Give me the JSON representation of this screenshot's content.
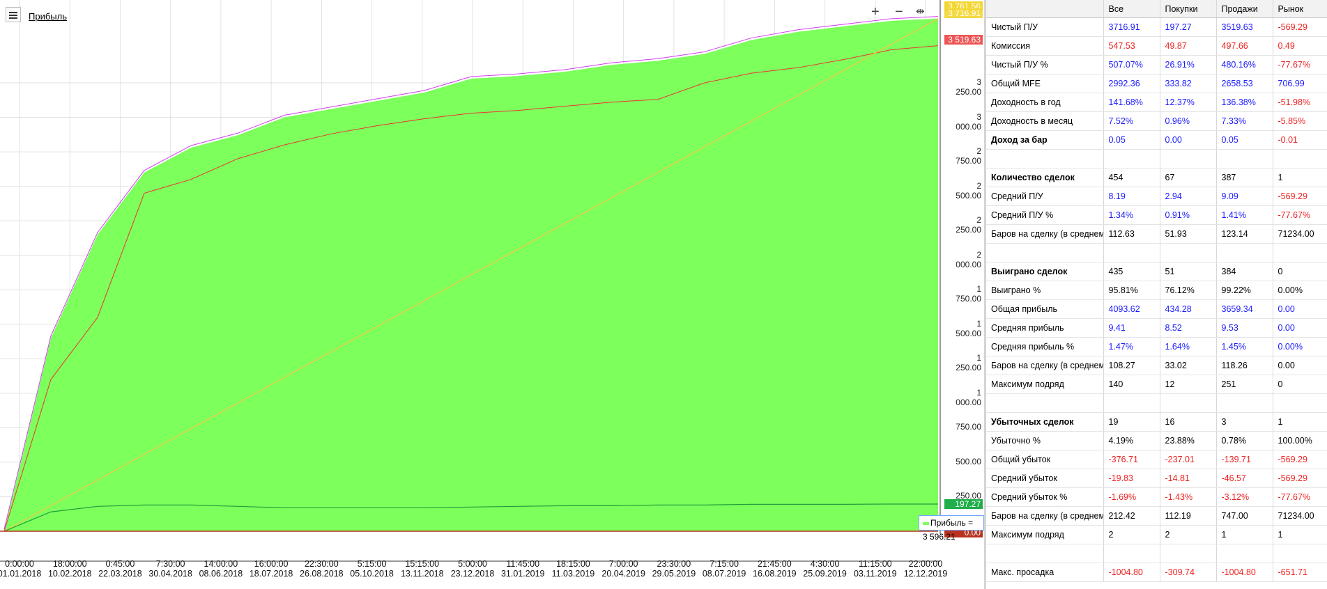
{
  "chart": {
    "title": "Прибыль",
    "tooltip": "Прибыль = 3 596.21",
    "value_tags": {
      "top": "3 761.56",
      "top2": "3 716.91",
      "red": "3 519.63",
      "green": "197.27",
      "zero": "0.00"
    },
    "colors": {
      "area": "#7dff5c",
      "max_line": "#d23cf0",
      "profit_line": "#ee3333",
      "trend_line": "#f5c542",
      "long_line": "#1f9e3c",
      "short_line": "#b8321f",
      "tag_yellow": "#f3d630",
      "tag_red": "#ee5555",
      "tag_green": "#1fae4a",
      "tag_brown": "#b8321f"
    },
    "icons": [
      "list-icon",
      "zoom-in-icon",
      "zoom-out-icon",
      "fit-icon"
    ]
  },
  "chart_data": {
    "type": "area",
    "title": "Прибыль",
    "ylim": [
      0,
      3800
    ],
    "y_ticks": [
      "250.00",
      "500.00",
      "750.00",
      "1 000.00",
      "1 250.00",
      "1 500.00",
      "1 750.00",
      "2 000.00",
      "2 250.00",
      "2 500.00",
      "2 750.00",
      "3 000.00",
      "3 250.00"
    ],
    "y_tick_values": [
      250,
      500,
      750,
      1000,
      1250,
      1500,
      1750,
      2000,
      2250,
      2500,
      2750,
      3000,
      3250
    ],
    "x_ticks": [
      {
        "time": "0:00:00",
        "date": "01.01.2018"
      },
      {
        "time": "18:00:00",
        "date": "10.02.2018"
      },
      {
        "time": "0:45:00",
        "date": "22.03.2018"
      },
      {
        "time": "7:30:00",
        "date": "30.04.2018"
      },
      {
        "time": "14:00:00",
        "date": "08.06.2018"
      },
      {
        "time": "16:00:00",
        "date": "18.07.2018"
      },
      {
        "time": "22:30:00",
        "date": "26.08.2018"
      },
      {
        "time": "5:15:00",
        "date": "05.10.2018"
      },
      {
        "time": "15:15:00",
        "date": "13.11.2018"
      },
      {
        "time": "5:00:00",
        "date": "23.12.2018"
      },
      {
        "time": "11:45:00",
        "date": "31.01.2019"
      },
      {
        "time": "18:15:00",
        "date": "11.03.2019"
      },
      {
        "time": "7:00:00",
        "date": "20.04.2019"
      },
      {
        "time": "23:30:00",
        "date": "29.05.2019"
      },
      {
        "time": "7:15:00",
        "date": "08.07.2019"
      },
      {
        "time": "21:45:00",
        "date": "16.08.2019"
      },
      {
        "time": "4:30:00",
        "date": "25.09.2019"
      },
      {
        "time": "11:15:00",
        "date": "03.11.2019"
      },
      {
        "time": "22:00:00",
        "date": "12.12.2019"
      }
    ],
    "series": [
      {
        "name": "Прибыль",
        "values": [
          0,
          1400,
          2150,
          2600,
          2780,
          2870,
          3000,
          3060,
          3120,
          3180,
          3280,
          3300,
          3330,
          3380,
          3410,
          3460,
          3560,
          3620,
          3660,
          3700,
          3716
        ]
      },
      {
        "name": "",
        "values": [
          0,
          1100,
          1550,
          2450,
          2550,
          2700,
          2800,
          2880,
          2940,
          2990,
          3030,
          3050,
          3080,
          3110,
          3130,
          3250,
          3320,
          3360,
          3420,
          3490,
          3519
        ]
      },
      {
        "name": "",
        "values": [
          0,
          140,
          180,
          190,
          190,
          180,
          170,
          170,
          170,
          170,
          175,
          180,
          185,
          185,
          190,
          190,
          195,
          195,
          195,
          197,
          197
        ]
      }
    ],
    "x_index": [
      0,
      1,
      2,
      3,
      4,
      5,
      6,
      7,
      8,
      9,
      10,
      11,
      12,
      13,
      14,
      15,
      16,
      17,
      18,
      19,
      20
    ]
  },
  "stats": {
    "columns": [
      "",
      "Все",
      "Покупки",
      "Продажи",
      "Рынок"
    ],
    "rows": [
      {
        "label": "Чистый П/У",
        "bold": false,
        "vals": [
          "3716.91",
          "197.27",
          "3519.63",
          "-569.29"
        ],
        "colors": [
          "blue",
          "blue",
          "blue",
          "red"
        ]
      },
      {
        "label": "Комиссия",
        "bold": false,
        "vals": [
          "547.53",
          "49.87",
          "497.66",
          "0.49"
        ],
        "colors": [
          "red",
          "red",
          "red",
          "red"
        ]
      },
      {
        "label": "Чистый П/У %",
        "bold": false,
        "vals": [
          "507.07%",
          "26.91%",
          "480.16%",
          "-77.67%"
        ],
        "colors": [
          "blue",
          "blue",
          "blue",
          "red"
        ]
      },
      {
        "label": "Общий MFE",
        "bold": false,
        "vals": [
          "2992.36",
          "333.82",
          "2658.53",
          "706.99"
        ],
        "colors": [
          "blue",
          "blue",
          "blue",
          "blue"
        ]
      },
      {
        "label": "Доходность в год",
        "bold": false,
        "vals": [
          "141.68%",
          "12.37%",
          "136.38%",
          "-51.98%"
        ],
        "colors": [
          "blue",
          "blue",
          "blue",
          "red"
        ]
      },
      {
        "label": "Доходность в месяц",
        "bold": false,
        "vals": [
          "7.52%",
          "0.96%",
          "7.33%",
          "-5.85%"
        ],
        "colors": [
          "blue",
          "blue",
          "blue",
          "red"
        ]
      },
      {
        "label": "Доход за бар",
        "bold": true,
        "vals": [
          "0.05",
          "0.00",
          "0.05",
          "-0.01"
        ],
        "colors": [
          "blue",
          "blue",
          "blue",
          "red"
        ]
      },
      {
        "label": "",
        "bold": false,
        "vals": [
          "",
          "",
          "",
          ""
        ],
        "colors": [
          "black",
          "black",
          "black",
          "black"
        ]
      },
      {
        "label": "Количество сделок",
        "bold": true,
        "vals": [
          "454",
          "67",
          "387",
          "1"
        ],
        "colors": [
          "black",
          "black",
          "black",
          "black"
        ]
      },
      {
        "label": "Средний П/У",
        "bold": false,
        "vals": [
          "8.19",
          "2.94",
          "9.09",
          "-569.29"
        ],
        "colors": [
          "blue",
          "blue",
          "blue",
          "red"
        ]
      },
      {
        "label": "Средний П/У %",
        "bold": false,
        "vals": [
          "1.34%",
          "0.91%",
          "1.41%",
          "-77.67%"
        ],
        "colors": [
          "blue",
          "blue",
          "blue",
          "red"
        ]
      },
      {
        "label": "Баров на сделку (в среднем)",
        "bold": false,
        "vals": [
          "112.63",
          "51.93",
          "123.14",
          "71234.00"
        ],
        "colors": [
          "black",
          "black",
          "black",
          "black"
        ]
      },
      {
        "label": "",
        "bold": false,
        "vals": [
          "",
          "",
          "",
          ""
        ],
        "colors": [
          "black",
          "black",
          "black",
          "black"
        ]
      },
      {
        "label": "Выиграно сделок",
        "bold": true,
        "vals": [
          "435",
          "51",
          "384",
          "0"
        ],
        "colors": [
          "black",
          "black",
          "black",
          "black"
        ]
      },
      {
        "label": "Выиграно %",
        "bold": false,
        "vals": [
          "95.81%",
          "76.12%",
          "99.22%",
          "0.00%"
        ],
        "colors": [
          "black",
          "black",
          "black",
          "black"
        ]
      },
      {
        "label": "Общая прибыль",
        "bold": false,
        "vals": [
          "4093.62",
          "434.28",
          "3659.34",
          "0.00"
        ],
        "colors": [
          "blue",
          "blue",
          "blue",
          "blue"
        ]
      },
      {
        "label": "Средняя прибыль",
        "bold": false,
        "vals": [
          "9.41",
          "8.52",
          "9.53",
          "0.00"
        ],
        "colors": [
          "blue",
          "blue",
          "blue",
          "blue"
        ]
      },
      {
        "label": "Средняя прибыль %",
        "bold": false,
        "vals": [
          "1.47%",
          "1.64%",
          "1.45%",
          "0.00%"
        ],
        "colors": [
          "blue",
          "blue",
          "blue",
          "blue"
        ]
      },
      {
        "label": "Баров на сделку (в среднем)",
        "bold": false,
        "vals": [
          "108.27",
          "33.02",
          "118.26",
          "0.00"
        ],
        "colors": [
          "black",
          "black",
          "black",
          "black"
        ]
      },
      {
        "label": "Максимум подряд",
        "bold": false,
        "vals": [
          "140",
          "12",
          "251",
          "0"
        ],
        "colors": [
          "black",
          "black",
          "black",
          "black"
        ]
      },
      {
        "label": "",
        "bold": false,
        "vals": [
          "",
          "",
          "",
          ""
        ],
        "colors": [
          "black",
          "black",
          "black",
          "black"
        ]
      },
      {
        "label": "Убыточных сделок",
        "bold": true,
        "vals": [
          "19",
          "16",
          "3",
          "1"
        ],
        "colors": [
          "black",
          "black",
          "black",
          "black"
        ]
      },
      {
        "label": "Убыточно %",
        "bold": false,
        "vals": [
          "4.19%",
          "23.88%",
          "0.78%",
          "100.00%"
        ],
        "colors": [
          "black",
          "black",
          "black",
          "black"
        ]
      },
      {
        "label": "Общий убыток",
        "bold": false,
        "vals": [
          "-376.71",
          "-237.01",
          "-139.71",
          "-569.29"
        ],
        "colors": [
          "red",
          "red",
          "red",
          "red"
        ]
      },
      {
        "label": "Средний убыток",
        "bold": false,
        "vals": [
          "-19.83",
          "-14.81",
          "-46.57",
          "-569.29"
        ],
        "colors": [
          "red",
          "red",
          "red",
          "red"
        ]
      },
      {
        "label": "Средний убыток %",
        "bold": false,
        "vals": [
          "-1.69%",
          "-1.43%",
          "-3.12%",
          "-77.67%"
        ],
        "colors": [
          "red",
          "red",
          "red",
          "red"
        ]
      },
      {
        "label": "Баров на сделку (в среднем)",
        "bold": false,
        "vals": [
          "212.42",
          "112.19",
          "747.00",
          "71234.00"
        ],
        "colors": [
          "black",
          "black",
          "black",
          "black"
        ]
      },
      {
        "label": "Максимум подряд",
        "bold": false,
        "vals": [
          "2",
          "2",
          "1",
          "1"
        ],
        "colors": [
          "black",
          "black",
          "black",
          "black"
        ]
      },
      {
        "label": "",
        "bold": false,
        "vals": [
          "",
          "",
          "",
          ""
        ],
        "colors": [
          "black",
          "black",
          "black",
          "black"
        ]
      },
      {
        "label": "Макс. просадка",
        "bold": false,
        "vals": [
          "-1004.80",
          "-309.74",
          "-1004.80",
          "-651.71"
        ],
        "colors": [
          "red",
          "red",
          "red",
          "red"
        ]
      }
    ]
  }
}
